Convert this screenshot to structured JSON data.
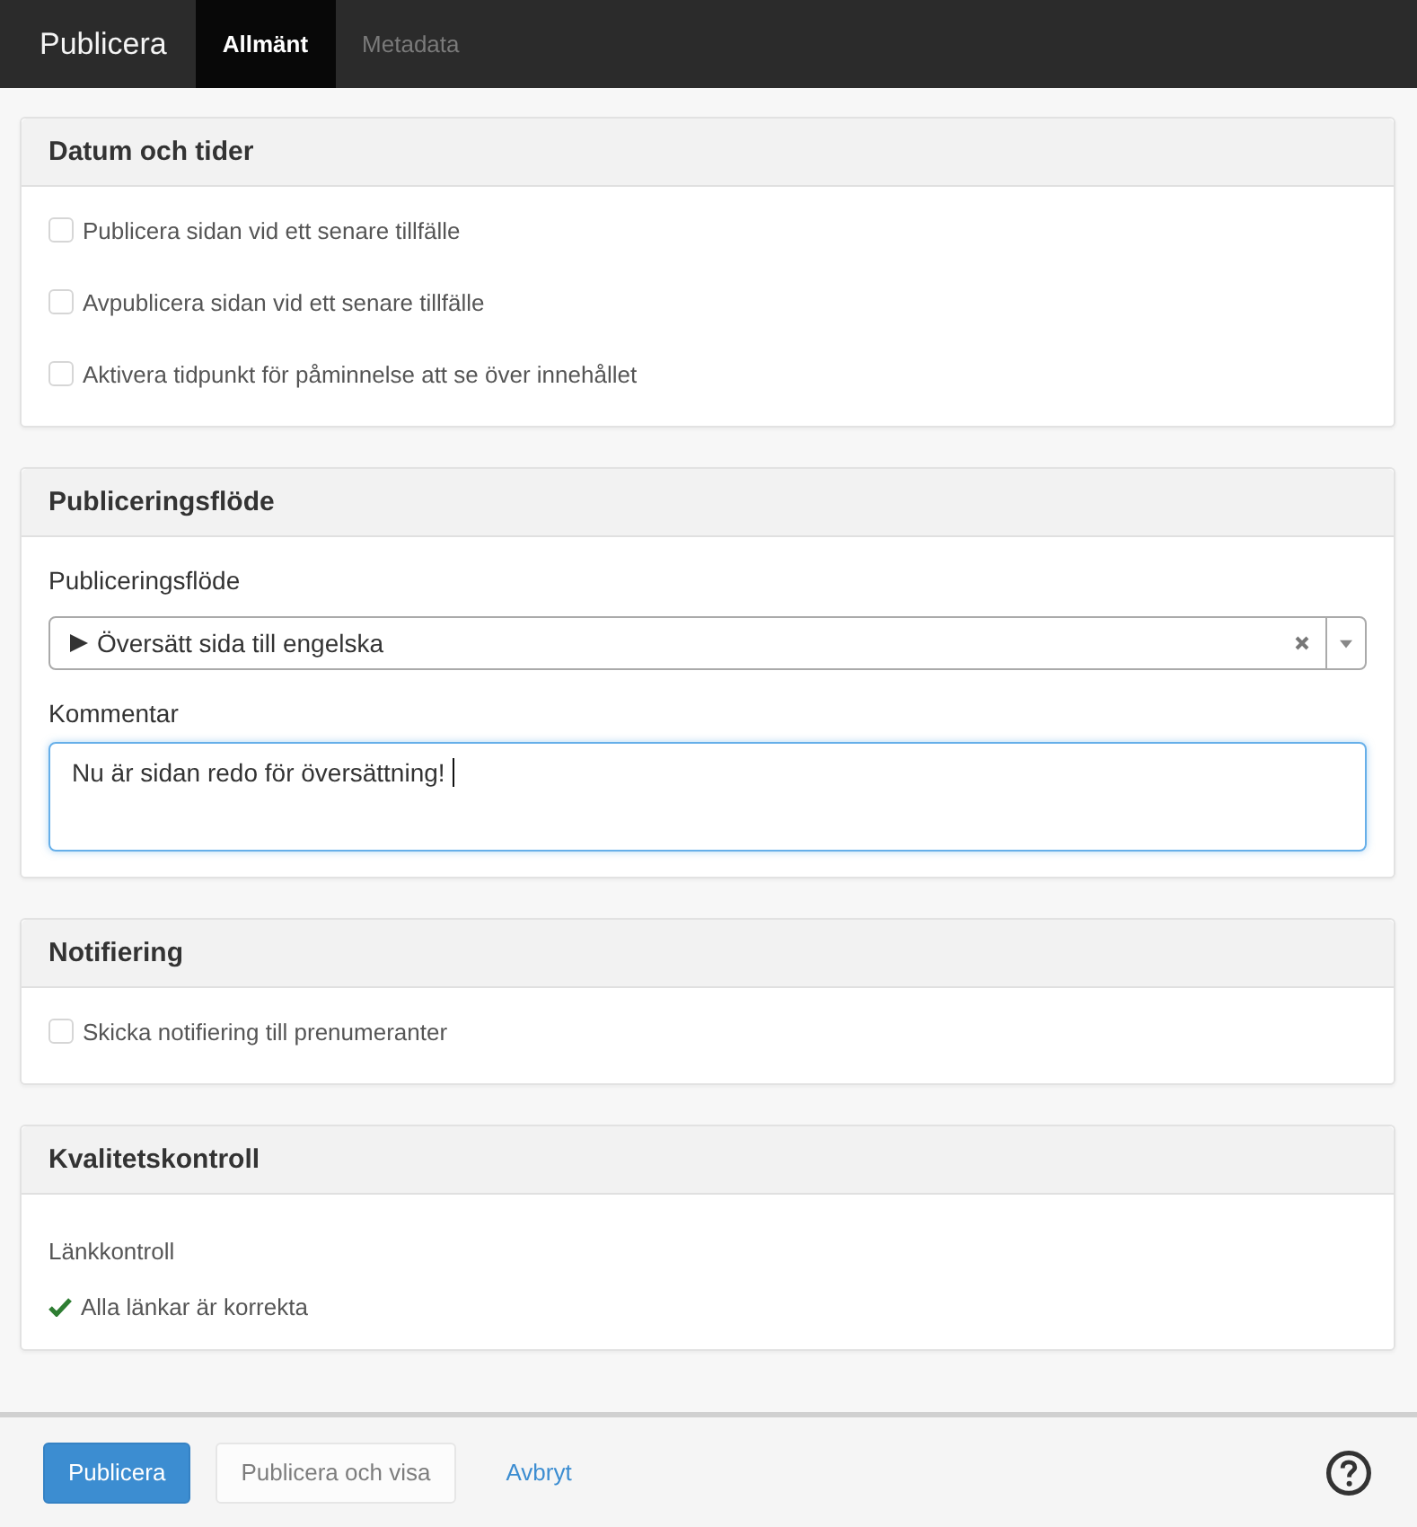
{
  "header": {
    "title": "Publicera",
    "tabs": [
      {
        "label": "Allmänt",
        "selected": true
      },
      {
        "label": "Metadata",
        "selected": false
      }
    ]
  },
  "panels": [
    {
      "kind": "checkboxes",
      "title": "Datum och tider",
      "options": [
        {
          "label": "Publicera sidan vid ett senare tillfälle",
          "checked": false
        },
        {
          "label": "Avpublicera sidan vid ett senare tillfälle",
          "checked": false
        },
        {
          "label": "Aktivera tidpunkt för påminnelse att se över innehållet",
          "checked": false
        }
      ]
    },
    {
      "kind": "workflow",
      "title": "Publiceringsflöde",
      "select": {
        "label": "Publiceringsflöde",
        "value": "Översätt sida till engelska"
      },
      "comment": {
        "label": "Kommentar",
        "value": "Nu är sidan redo för översättning!",
        "focused": true
      }
    },
    {
      "kind": "checkboxes",
      "title": "Notifiering",
      "options": [
        {
          "label": "Skicka notifiering till prenumeranter",
          "checked": false
        }
      ]
    },
    {
      "kind": "link_check",
      "title": "Kvalitetskontroll",
      "label": "Länkkontroll",
      "result": "Alla länkar är korrekta"
    }
  ],
  "footer": {
    "buttons": [
      {
        "kind": "primary",
        "label": "Publicera",
        "disabled": false
      },
      {
        "kind": "default",
        "label": "Publicera och visa",
        "disabled": true
      },
      {
        "kind": "link",
        "label": "Avbryt",
        "disabled": false
      }
    ]
  }
}
